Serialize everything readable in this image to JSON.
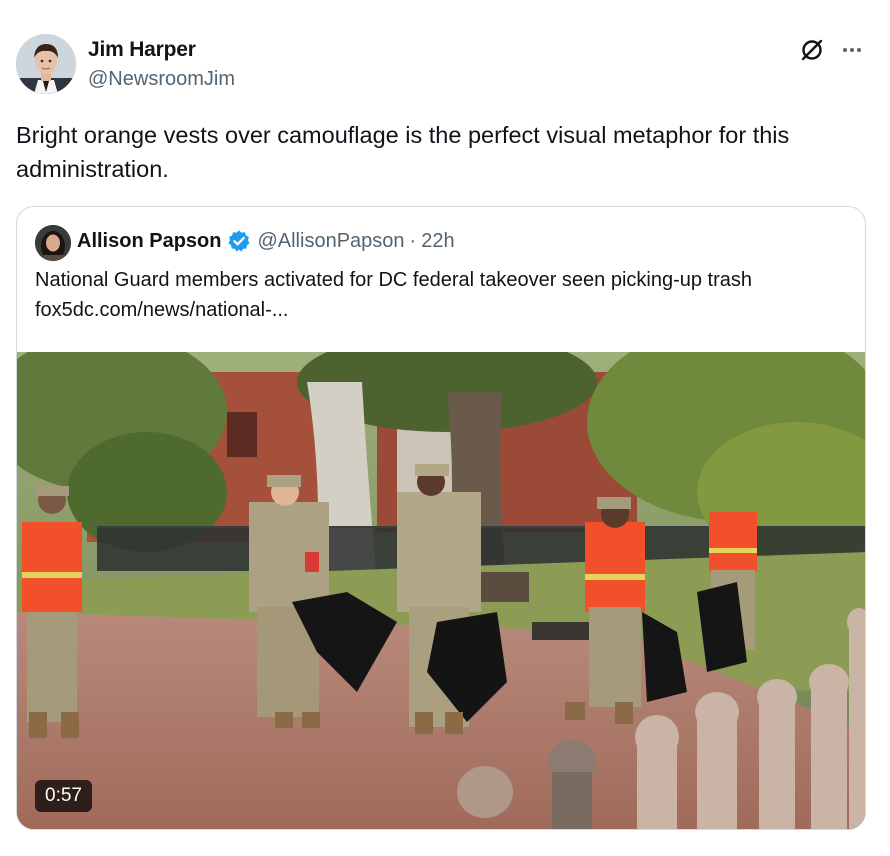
{
  "tweet": {
    "author": {
      "name": "Jim Harper",
      "handle": "@NewsroomJim"
    },
    "text": "Bright orange vests over camouflage is the perfect visual metaphor for this administration.",
    "icons": {
      "grok": "grok-icon",
      "more": "more-icon"
    }
  },
  "quoted_tweet": {
    "author": {
      "name": "Allison Papson",
      "handle": "@AllisonPapson",
      "verified": true
    },
    "separator": "·",
    "time": "22h",
    "text": "National Guard members activated for DC federal takeover seen picking-up trash fox5dc.com/news/national-...",
    "media": {
      "type": "video",
      "duration": "0:57"
    }
  },
  "colors": {
    "text": "#0f1419",
    "secondary": "#536471",
    "border": "#cfd9de",
    "verified": "#1d9bf0",
    "vest": "#f2502a"
  }
}
